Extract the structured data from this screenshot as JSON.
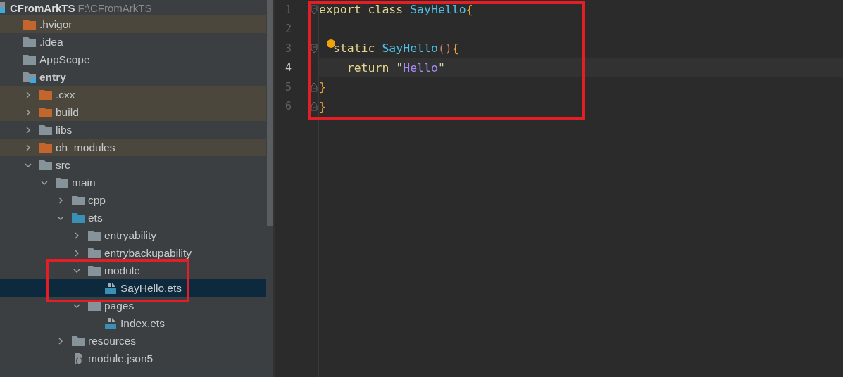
{
  "project": {
    "name": "CFromArkTS",
    "path": "F:\\CFromArkTS"
  },
  "tree": [
    {
      "name": ".hvigor",
      "kind": "excluded",
      "selected": false
    },
    {
      "name": ".idea",
      "kind": "folder",
      "selected": false
    },
    {
      "name": "AppScope",
      "kind": "folder",
      "selected": false
    },
    {
      "name": "entry",
      "kind": "module",
      "selected": false,
      "children": [
        {
          "name": ".cxx",
          "kind": "excluded",
          "expanded": false,
          "selected": false
        },
        {
          "name": "build",
          "kind": "excluded",
          "expanded": false,
          "selected": false
        },
        {
          "name": "libs",
          "kind": "folder",
          "expanded": false,
          "selected": false
        },
        {
          "name": "oh_modules",
          "kind": "excluded",
          "expanded": false,
          "selected": false
        },
        {
          "name": "src",
          "kind": "folder",
          "expanded": true,
          "selected": false,
          "children": [
            {
              "name": "main",
              "kind": "folder",
              "expanded": true,
              "selected": false,
              "children": [
                {
                  "name": "cpp",
                  "kind": "folder",
                  "expanded": false,
                  "selected": false
                },
                {
                  "name": "ets",
                  "kind": "source",
                  "expanded": true,
                  "selected": false,
                  "children": [
                    {
                      "name": "entryability",
                      "kind": "folder",
                      "expanded": false,
                      "selected": false
                    },
                    {
                      "name": "entrybackupability",
                      "kind": "folder",
                      "expanded": false,
                      "selected": false
                    },
                    {
                      "name": "module",
                      "kind": "folder",
                      "expanded": true,
                      "selected": false,
                      "children": [
                        {
                          "name": "SayHello.ets",
                          "kind": "ets",
                          "selected": true
                        }
                      ]
                    },
                    {
                      "name": "pages",
                      "kind": "folder",
                      "expanded": true,
                      "selected": false,
                      "children": [
                        {
                          "name": "Index.ets",
                          "kind": "ets",
                          "selected": false
                        }
                      ]
                    }
                  ]
                },
                {
                  "name": "resources",
                  "kind": "folder",
                  "expanded": false,
                  "selected": false
                },
                {
                  "name": "module.json5",
                  "kind": "json",
                  "selected": false
                }
              ]
            }
          ]
        }
      ]
    }
  ],
  "editor": {
    "lines": [
      {
        "number": "1",
        "current": false,
        "fold_open": true,
        "fold_close": false,
        "bulb": false,
        "tokens": [
          {
            "text": "export class ",
            "kind": "keyword"
          },
          {
            "text": "SayHello",
            "kind": "name"
          },
          {
            "text": "{",
            "kind": "brace"
          }
        ]
      },
      {
        "number": "2",
        "current": false,
        "fold_open": false,
        "fold_close": false,
        "bulb": false
      },
      {
        "number": "3",
        "current": false,
        "fold_open": true,
        "fold_close": false,
        "bulb": true,
        "tokens": [
          {
            "text": "  static ",
            "kind": "keyword"
          },
          {
            "text": "SayHello",
            "kind": "name"
          },
          {
            "text": "()",
            "kind": "paren"
          },
          {
            "text": "{",
            "kind": "brace"
          }
        ]
      },
      {
        "number": "4",
        "current": true,
        "fold_open": false,
        "fold_close": false,
        "bulb": false,
        "tokens": [
          {
            "text": "    return ",
            "kind": "keyword"
          },
          {
            "text": "\"",
            "kind": "quote"
          },
          {
            "text": "Hello",
            "kind": "string"
          },
          {
            "text": "\"",
            "kind": "quote"
          }
        ]
      },
      {
        "number": "5",
        "current": false,
        "fold_open": false,
        "fold_close": true,
        "bulb": false,
        "tokens": [
          {
            "text": "}",
            "kind": "brace"
          }
        ]
      },
      {
        "number": "6",
        "current": false,
        "fold_open": false,
        "fold_close": true,
        "bulb": false,
        "tokens": [
          {
            "text": "}",
            "kind": "brace"
          }
        ]
      }
    ]
  }
}
